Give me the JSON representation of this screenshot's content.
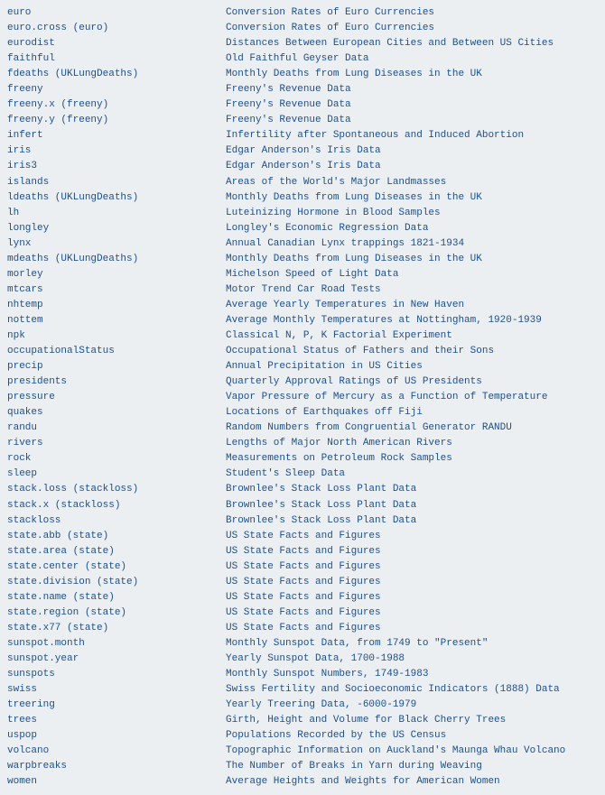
{
  "datasets": [
    {
      "name": "euro",
      "desc": "Conversion Rates of Euro Currencies"
    },
    {
      "name": "euro.cross (euro)",
      "desc": "Conversion Rates of Euro Currencies"
    },
    {
      "name": "eurodist",
      "desc": "Distances Between European Cities and Between US Cities"
    },
    {
      "name": "faithful",
      "desc": "Old Faithful Geyser Data"
    },
    {
      "name": "fdeaths (UKLungDeaths)",
      "desc": "Monthly Deaths from Lung Diseases in the UK"
    },
    {
      "name": "freeny",
      "desc": "Freeny's Revenue Data"
    },
    {
      "name": "freeny.x (freeny)",
      "desc": "Freeny's Revenue Data"
    },
    {
      "name": "freeny.y (freeny)",
      "desc": "Freeny's Revenue Data"
    },
    {
      "name": "infert",
      "desc": "Infertility after Spontaneous and Induced Abortion"
    },
    {
      "name": "iris",
      "desc": "Edgar Anderson's Iris Data"
    },
    {
      "name": "iris3",
      "desc": "Edgar Anderson's Iris Data"
    },
    {
      "name": "islands",
      "desc": "Areas of the World's Major Landmasses"
    },
    {
      "name": "ldeaths (UKLungDeaths)",
      "desc": "Monthly Deaths from Lung Diseases in the UK"
    },
    {
      "name": "lh",
      "desc": "Luteinizing Hormone in Blood Samples"
    },
    {
      "name": "longley",
      "desc": "Longley's Economic Regression Data"
    },
    {
      "name": "lynx",
      "desc": "Annual Canadian Lynx trappings 1821-1934"
    },
    {
      "name": "mdeaths (UKLungDeaths)",
      "desc": "Monthly Deaths from Lung Diseases in the UK"
    },
    {
      "name": "morley",
      "desc": "Michelson Speed of Light Data"
    },
    {
      "name": "mtcars",
      "desc": "Motor Trend Car Road Tests"
    },
    {
      "name": "nhtemp",
      "desc": "Average Yearly Temperatures in New Haven"
    },
    {
      "name": "nottem",
      "desc": "Average Monthly Temperatures at Nottingham, 1920-1939"
    },
    {
      "name": "npk",
      "desc": "Classical N, P, K Factorial Experiment"
    },
    {
      "name": "occupationalStatus",
      "desc": "Occupational Status of Fathers and their Sons"
    },
    {
      "name": "precip",
      "desc": "Annual Precipitation in US Cities"
    },
    {
      "name": "presidents",
      "desc": "Quarterly Approval Ratings of US Presidents"
    },
    {
      "name": "pressure",
      "desc": "Vapor Pressure of Mercury as a Function of Temperature"
    },
    {
      "name": "quakes",
      "desc": "Locations of Earthquakes off Fiji"
    },
    {
      "name": "randu",
      "desc": "Random Numbers from Congruential Generator RANDU"
    },
    {
      "name": "rivers",
      "desc": "Lengths of Major North American Rivers"
    },
    {
      "name": "rock",
      "desc": "Measurements on Petroleum Rock Samples"
    },
    {
      "name": "sleep",
      "desc": "Student's Sleep Data"
    },
    {
      "name": "stack.loss (stackloss)",
      "desc": "Brownlee's Stack Loss Plant Data"
    },
    {
      "name": "stack.x (stackloss)",
      "desc": "Brownlee's Stack Loss Plant Data"
    },
    {
      "name": "stackloss",
      "desc": "Brownlee's Stack Loss Plant Data"
    },
    {
      "name": "state.abb (state)",
      "desc": "US State Facts and Figures"
    },
    {
      "name": "state.area (state)",
      "desc": "US State Facts and Figures"
    },
    {
      "name": "state.center (state)",
      "desc": "US State Facts and Figures"
    },
    {
      "name": "state.division (state)",
      "desc": "US State Facts and Figures"
    },
    {
      "name": "state.name (state)",
      "desc": "US State Facts and Figures"
    },
    {
      "name": "state.region (state)",
      "desc": "US State Facts and Figures"
    },
    {
      "name": "state.x77 (state)",
      "desc": "US State Facts and Figures"
    },
    {
      "name": "sunspot.month",
      "desc": "Monthly Sunspot Data, from 1749 to \"Present\""
    },
    {
      "name": "sunspot.year",
      "desc": "Yearly Sunspot Data, 1700-1988"
    },
    {
      "name": "sunspots",
      "desc": "Monthly Sunspot Numbers, 1749-1983"
    },
    {
      "name": "swiss",
      "desc": "Swiss Fertility and Socioeconomic Indicators (1888) Data"
    },
    {
      "name": "treering",
      "desc": "Yearly Treering Data, -6000-1979"
    },
    {
      "name": "trees",
      "desc": "Girth, Height and Volume for Black Cherry Trees"
    },
    {
      "name": "uspop",
      "desc": "Populations Recorded by the US Census"
    },
    {
      "name": "volcano",
      "desc": "Topographic Information on Auckland's Maunga Whau Volcano"
    },
    {
      "name": "warpbreaks",
      "desc": "The Number of Breaks in Yarn during Weaving"
    },
    {
      "name": "women",
      "desc": "Average Heights and Weights for American Women"
    }
  ]
}
